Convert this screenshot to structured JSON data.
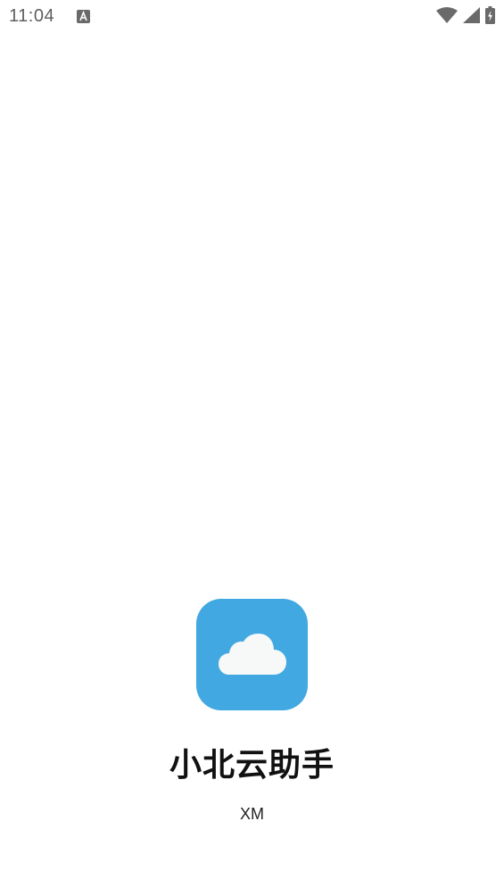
{
  "status_bar": {
    "time": "11:04",
    "icons": [
      "text-input-notification-icon",
      "wifi-icon",
      "cell-signal-icon",
      "battery-charging-icon"
    ]
  },
  "splash": {
    "app_name": "小北云助手",
    "author": "XM",
    "icon": "cloud-icon",
    "icon_background": "#42a8e1"
  }
}
